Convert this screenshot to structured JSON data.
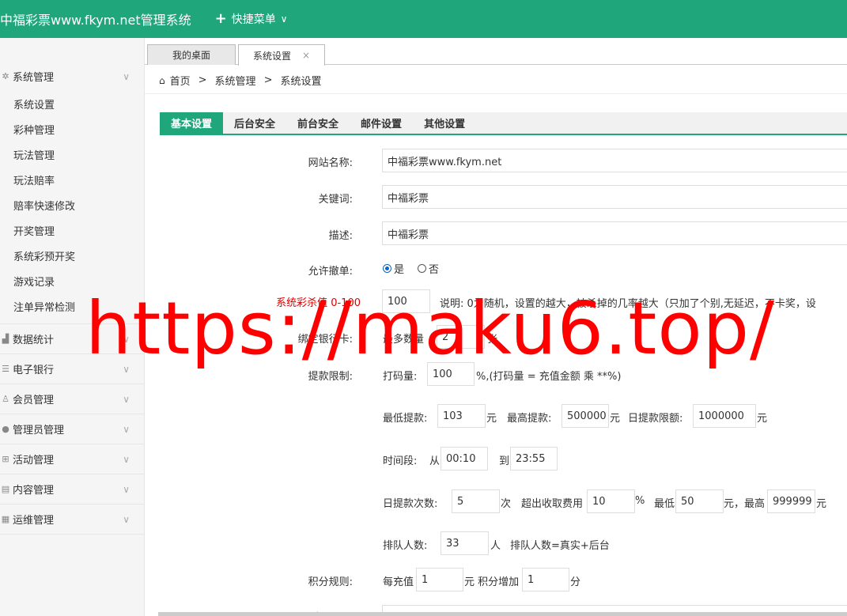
{
  "header": {
    "brand": "中福彩票www.fkym.net管理系统",
    "quick_menu": "快捷菜单"
  },
  "sidebar": {
    "groups": [
      {
        "label": "系统管理",
        "icon": "gear-icon",
        "items": [
          "系统设置",
          "彩种管理",
          "玩法管理",
          "玩法赔率",
          "赔率快速修改",
          "开奖管理",
          "系统彩预开奖",
          "游戏记录",
          "注单异常检测"
        ]
      },
      {
        "label": "数据统计",
        "icon": "chart-icon"
      },
      {
        "label": "电子银行",
        "icon": "list-icon"
      },
      {
        "label": "会员管理",
        "icon": "user-icon"
      },
      {
        "label": "管理员管理",
        "icon": "admin-icon"
      },
      {
        "label": "活动管理",
        "icon": "gift-icon"
      },
      {
        "label": "内容管理",
        "icon": "document-icon"
      },
      {
        "label": "运维管理",
        "icon": "tools-icon"
      }
    ]
  },
  "tabs": {
    "desktop": "我的桌面",
    "settings": "系统设置",
    "close": "×"
  },
  "breadcrumb": {
    "home": "首页",
    "sep": ">",
    "level1": "系统管理",
    "level2": "系统设置"
  },
  "setting_tabs": [
    "基本设置",
    "后台安全",
    "前台安全",
    "邮件设置",
    "其他设置"
  ],
  "form": {
    "site_name_label": "网站名称:",
    "site_name": "中福彩票www.fkym.net",
    "keywords_label": "关键词:",
    "keywords": "中福彩票",
    "desc_label": "描述:",
    "desc": "中福彩票",
    "cancel_label": "允许撤单:",
    "cancel_yes": "是",
    "cancel_no": "否",
    "kill_label": "系统彩杀值 0-100",
    "kill_value": "100",
    "kill_note": "说明: 0为随机，设置的越大，被杀掉的几率越大（只加了个别,无延迟，不卡奖，设",
    "bind_label": "绑定银行卡:",
    "bind_prefix": "最多数量",
    "bind_value": "2",
    "bind_unit": "张",
    "withdraw_label": "提款限制:",
    "bet_prefix": "打码量:",
    "bet_value": "100",
    "bet_note": "%,(打码量 = 充值金额 乘 **%)",
    "min_label": "最低提款:",
    "min_value": "103",
    "yuan": "元",
    "max_label": "最高提款:",
    "max_value": "500000",
    "daily_label": "日提款限额:",
    "daily_value": "1000000",
    "time_label": "时间段:",
    "from": "从",
    "time_from": "00:10",
    "to": "到",
    "time_to": "23:55",
    "times_label": "日提款次数:",
    "times_value": "5",
    "times_unit": "次",
    "fee_label": "超出收取费用",
    "fee_value": "10",
    "percent": "%",
    "fee_min_label": "最低",
    "fee_min": "50",
    "fee_max_label": "元，最高",
    "fee_max": "999999",
    "queue_label": "排队人数:",
    "queue_value": "33",
    "queue_unit": "人",
    "queue_note": "排队人数=真实+后台",
    "points_label": "积分规则:",
    "points_prefix": "每充值",
    "points_value": "1",
    "points_mid": "元 积分增加",
    "points_add": "1",
    "points_unit": "分",
    "qq_label": "客服QQ:"
  },
  "watermark": "https://maku6.top/"
}
